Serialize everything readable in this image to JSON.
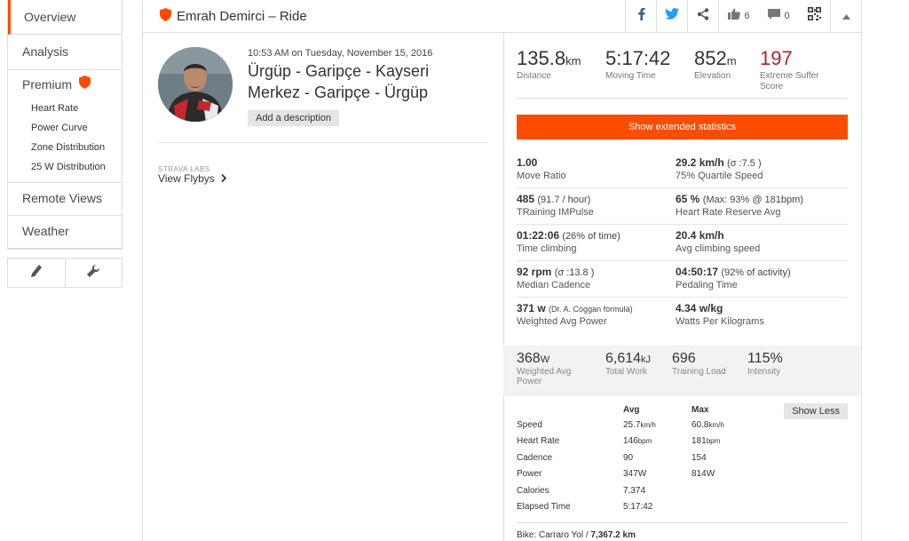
{
  "sidebar": {
    "overview": "Overview",
    "analysis": "Analysis",
    "premium": "Premium",
    "premium_items": [
      "Heart Rate",
      "Power Curve",
      "Zone Distribution",
      "25 W Distribution"
    ],
    "remote_views": "Remote Views",
    "weather": "Weather"
  },
  "header": {
    "title": "Emrah Demirci – Ride",
    "kudos_count": "6",
    "comments_count": "0"
  },
  "activity": {
    "datetime": "10:53 AM on Tuesday, November 15, 2016",
    "title": "Ürgüp - Garipçe - Kayseri Merkez - Garipçe - Ürgüp",
    "add_description": "Add a description",
    "labs_label": "STRAVA LABS",
    "flybys": "View Flybys"
  },
  "big_stats": {
    "distance": {
      "value": "135.8",
      "unit": "km",
      "label": "Distance"
    },
    "moving_time": {
      "value": "5:17:42",
      "unit": "",
      "label": "Moving Time"
    },
    "elevation": {
      "value": "852",
      "unit": "m",
      "label": "Elevation"
    },
    "suffer": {
      "value": "197",
      "unit": "",
      "label": "Extreme Suffer Score"
    }
  },
  "extended_button": "Show extended statistics",
  "extended": [
    {
      "value": "1.00",
      "note": "",
      "label": "Move Ratio"
    },
    {
      "value": "29.2 km/h",
      "note": "(σ :7.5 )",
      "label": "75% Quartile Speed"
    },
    {
      "value": "485",
      "note": "(91.7 / hour)",
      "label": "TRaining IMPulse"
    },
    {
      "value": "65 %",
      "note": "(Max: 93% @ 181bpm)",
      "label": "Heart Rate Reserve Avg"
    },
    {
      "value": "01:22:06",
      "note": "(26% of time)",
      "label": "Time climbing"
    },
    {
      "value": "20.4 km/h",
      "note": "",
      "label": "Avg climbing speed"
    },
    {
      "value": "92 rpm",
      "note": "(σ :13.8 )",
      "label": "Median Cadence"
    },
    {
      "value": "04:50:17",
      "note": "(92% of activity)",
      "label": "Pedaling Time"
    },
    {
      "value": "371 w",
      "note": "(Dr. A. Coggan formula)",
      "label": "Weighted Avg Power"
    },
    {
      "value": "4.34 w/kg",
      "note": "",
      "label": "Watts Per Kilograms"
    }
  ],
  "power_stats": {
    "weighted": {
      "value": "368",
      "unit": "W",
      "label": "Weighted Avg Power"
    },
    "work": {
      "value": "6,614",
      "unit": "kJ",
      "label": "Total Work"
    },
    "load": {
      "value": "696",
      "unit": "",
      "label": "Training Load"
    },
    "intensity": {
      "value": "115%",
      "unit": "",
      "label": "Intensity"
    }
  },
  "details": {
    "show_less": "Show Less",
    "avg_header": "Avg",
    "max_header": "Max",
    "rows": [
      {
        "label": "Speed",
        "avg": "25.7",
        "avg_unit": "km/h",
        "max": "60.8",
        "max_unit": "km/h"
      },
      {
        "label": "Heart Rate",
        "avg": "146",
        "avg_unit": "bpm",
        "max": "181",
        "max_unit": "bpm"
      },
      {
        "label": "Cadence",
        "avg": "90",
        "avg_unit": "",
        "max": "154",
        "max_unit": ""
      },
      {
        "label": "Power",
        "avg": "347",
        "avg_unit": "W",
        "max": "814",
        "max_unit": "W"
      },
      {
        "label": "Calories",
        "avg": "7,374",
        "avg_unit": "",
        "max": "",
        "max_unit": ""
      },
      {
        "label": "Elapsed Time",
        "avg": "5:17:42",
        "avg_unit": "",
        "max": "",
        "max_unit": ""
      }
    ]
  },
  "bike": {
    "prefix": "Bike: Carraro Yol / ",
    "distance": "7,367.2 km"
  },
  "colors": {
    "accent": "#fc4c02",
    "suffer": "#b0212d",
    "facebook": "#3b5998",
    "twitter": "#1da1f2"
  }
}
